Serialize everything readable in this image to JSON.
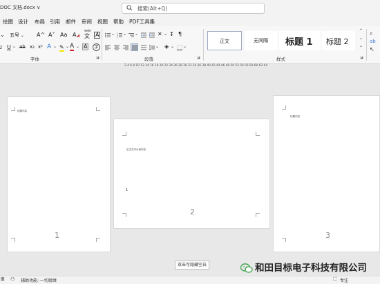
{
  "window": {
    "title": "DOC 文档.docx ∨",
    "search_placeholder": "搜索(Alt+Q)"
  },
  "menu_tabs": [
    "绘图",
    "设计",
    "布局",
    "引用",
    "邮件",
    "审阅",
    "视图",
    "帮助",
    "PDF工具集"
  ],
  "ribbon": {
    "font": {
      "font_size": "五号",
      "grow_label": "A^",
      "shrink_label": "A˅",
      "aa_label": "Aa",
      "clear_label": "A",
      "wen_label": "wén",
      "group_label": "字体"
    },
    "paragraph": {
      "group_label": "段落"
    },
    "styles": {
      "items": [
        "正文",
        "无间隔",
        "标题 1",
        "标题 2"
      ],
      "group_label": "样式"
    }
  },
  "ruler_text": "2  4  6  8  10 12 14 16 18 20 22 24 26 28 30 32 34 36 38 40 42 44 46 48 50 52 54 56 58 60 62 64",
  "pages": [
    {
      "number": "1",
      "snippet": "标题内容"
    },
    {
      "number": "2",
      "snippet": "正文文本示例内容",
      "mark": "1"
    },
    {
      "number": "3",
      "snippet": "标题内容"
    }
  ],
  "tooltip": "双击可隐藏空白",
  "statusbar": {
    "accessibility": "辅助功能: 一切就绪",
    "focus": "专注"
  },
  "watermark": "和田目标电子科技有限公司",
  "colors": {
    "accent": "#2b579a",
    "highlight_yellow": "#f5e400",
    "font_red": "#d4272e",
    "wechat_green": "#3ea048"
  }
}
